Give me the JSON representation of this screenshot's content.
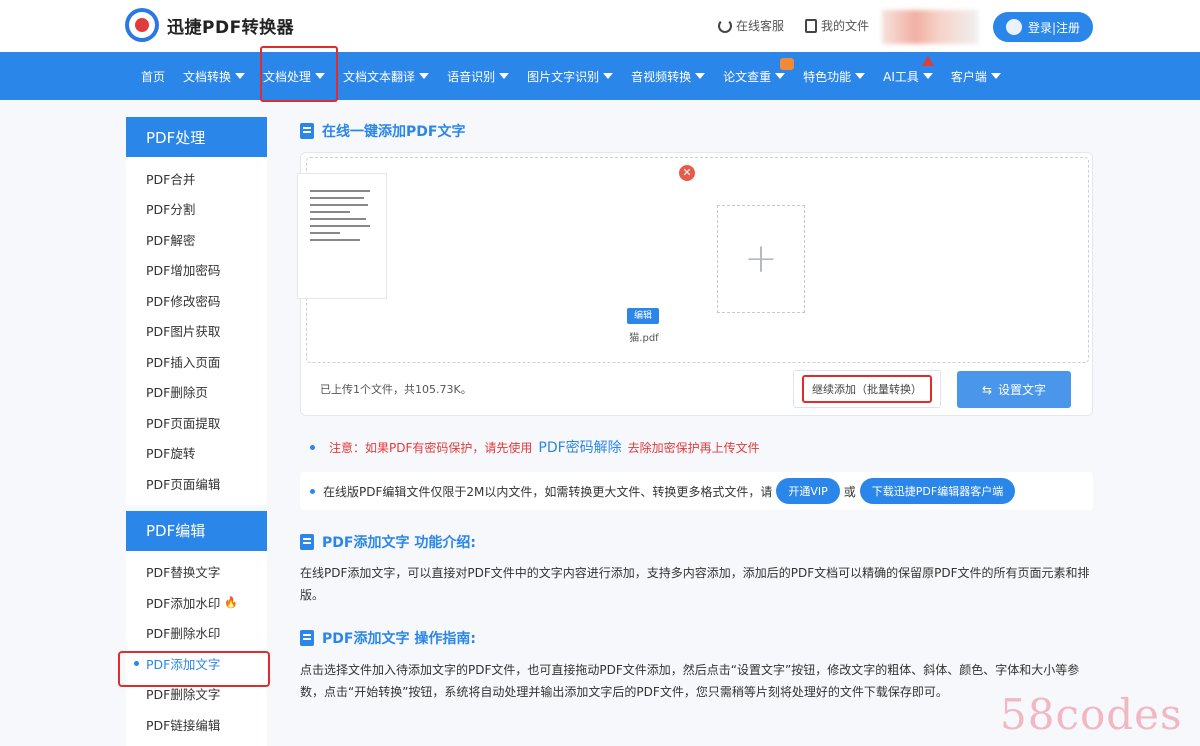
{
  "header": {
    "logo_text": "迅捷PDF转换器",
    "online_service": "在线客服",
    "my_files": "我的文件",
    "login": "登录|注册"
  },
  "nav": {
    "items": [
      {
        "label": "首页"
      },
      {
        "label": "文档转换"
      },
      {
        "label": "文档处理"
      },
      {
        "label": "文档文本翻译"
      },
      {
        "label": "语音识别"
      },
      {
        "label": "图片文字识别"
      },
      {
        "label": "音视频转换"
      },
      {
        "label": "论文查重"
      },
      {
        "label": "特色功能"
      },
      {
        "label": "AI工具"
      },
      {
        "label": "客户端"
      }
    ]
  },
  "sidebar": {
    "groups": [
      {
        "title": "PDF处理",
        "items": [
          "PDF合并",
          "PDF分割",
          "PDF解密",
          "PDF增加密码",
          "PDF修改密码",
          "PDF图片获取",
          "PDF插入页面",
          "PDF删除页",
          "PDF页面提取",
          "PDF旋转",
          "PDF页面编辑"
        ]
      },
      {
        "title": "PDF编辑",
        "items": [
          "PDF替换文字",
          "PDF添加水印",
          "PDF删除水印",
          "PDF添加文字",
          "PDF删除文字",
          "PDF链接编辑"
        ]
      }
    ]
  },
  "main": {
    "title": "在线一键添加PDF文字",
    "upload": {
      "edit_tag": "编辑",
      "file_name": "猫.pdf",
      "info": "已上传1个文件，共105.73K。",
      "continue": "继续添加（批量转换）",
      "set_text": "设置文字"
    },
    "notice": {
      "prefix": "注意：如果PDF有密码保护，请先使用",
      "link": "PDF密码解除",
      "suffix": "去除加密保护再上传文件"
    },
    "limit": {
      "text": "在线版PDF编辑文件仅限于2M以内文件，如需转换更大文件、转换更多格式文件，请",
      "vip": "开通VIP",
      "or": "或",
      "download": "下载迅捷PDF编辑器客户端"
    },
    "intro_title": "PDF添加文字 功能介绍:",
    "intro_text": "在线PDF添加文字，可以直接对PDF文件中的文字内容进行添加，支持多内容添加，添加后的PDF文档可以精确的保留原PDF文件的所有页面元素和排版。",
    "guide_title": "PDF添加文字 操作指南:",
    "guide_text": "点击选择文件加入待添加文字的PDF文件，也可直接拖动PDF文件添加，然后点击“设置文字”按钮，修改文字的粗体、斜体、颜色、字体和大小等参数，点击“开始转换”按钮，系统将自动处理并输出添加文字后的PDF文件，您只需稍等片刻将处理好的文件下载保存即可。"
  },
  "watermark": "58codes",
  "colors": {
    "brand": "#2b86ea",
    "highlight": "#e22b2b",
    "notice": "#e23b3b"
  }
}
